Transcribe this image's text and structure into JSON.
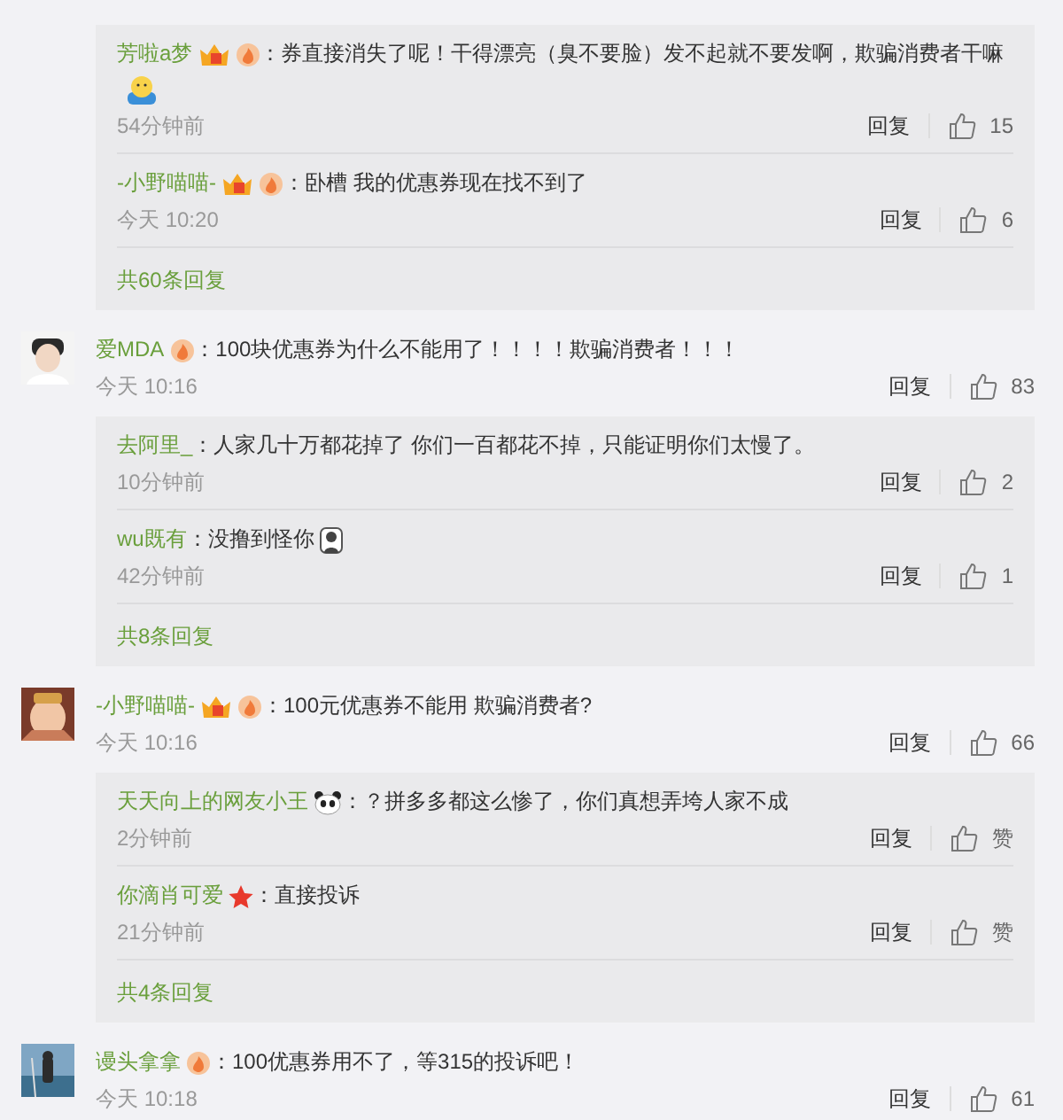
{
  "threads": [
    {
      "replies": [
        {
          "author": "芳啦a梦",
          "badges": [
            {
              "kind": "vip"
            },
            {
              "kind": "rank"
            }
          ],
          "text": "：券直接消失了呢！干得漂亮（臭不要脸）发不起就不要发啊，欺骗消费者干嘛",
          "emojis": [
            {
              "kind": "smile"
            }
          ],
          "time": "54分钟前",
          "reply": "回复",
          "likes": "15"
        },
        {
          "author": "-小野喵喵-",
          "badges": [
            {
              "kind": "vip"
            },
            {
              "kind": "rank"
            }
          ],
          "text": "：卧槽 我的优惠券现在找不到了",
          "time": "今天 10:20",
          "reply": "回复",
          "likes": "6"
        }
      ],
      "more": "共60条回复"
    },
    {
      "author": "爱MDA",
      "avatar": {
        "kind": "picture"
      },
      "badges": [
        {
          "kind": "rank"
        }
      ],
      "text": "：100块优惠券为什么不能用了！！！！欺骗消费者！！！",
      "time": "今天 10:16",
      "reply": "回复",
      "likes": "83",
      "replies": [
        {
          "author": "去阿里_",
          "text": "：人家几十万都花掉了  你们一百都花不掉，只能证明你们太慢了。",
          "time": "10分钟前",
          "reply": "回复",
          "likes": "2"
        },
        {
          "author": "wu既有",
          "text": "：没撸到怪你",
          "emojis": [
            {
              "kind": "figure"
            }
          ],
          "time": "42分钟前",
          "reply": "回复",
          "likes": "1"
        }
      ],
      "more": "共8条回复"
    },
    {
      "author": "-小野喵喵-",
      "avatar": {
        "kind": "picture"
      },
      "badges": [
        {
          "kind": "vip"
        },
        {
          "kind": "rank"
        }
      ],
      "text": "：100元优惠券不能用 欺骗消费者?",
      "time": "今天 10:16",
      "reply": "回复",
      "likes": "66",
      "replies": [
        {
          "author": "天天向上的网友小王",
          "badges": [
            {
              "kind": "panda"
            }
          ],
          "text": "：？拼多多都这么惨了，你们真想弄垮人家不成",
          "time": "2分钟前",
          "reply": "回复",
          "likes": "赞"
        },
        {
          "author": "你滴肖可爱",
          "badges": [
            {
              "kind": "star"
            }
          ],
          "text": "：直接投诉",
          "time": "21分钟前",
          "reply": "回复",
          "likes": "赞"
        }
      ],
      "more": "共4条回复"
    },
    {
      "author": "谩头拿拿",
      "avatar": {
        "kind": "picture"
      },
      "badges": [
        {
          "kind": "rank"
        }
      ],
      "text": "：100优惠券用不了，等315的投诉吧！",
      "time": "今天 10:18",
      "reply": "回复",
      "likes": "61"
    }
  ]
}
